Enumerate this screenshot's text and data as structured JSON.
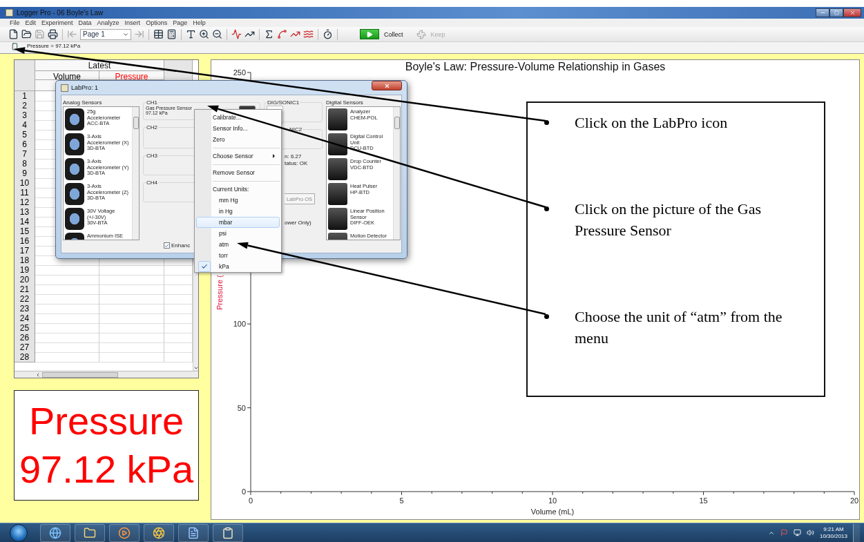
{
  "window": {
    "title": "Logger Pro - 06 Boyle's Law"
  },
  "menu": [
    "File",
    "Edit",
    "Experiment",
    "Data",
    "Analyze",
    "Insert",
    "Options",
    "Page",
    "Help"
  ],
  "toolbar": {
    "page": "Page 1",
    "buttons": [
      {
        "label": "Collect",
        "disabled": false
      },
      {
        "label": "Keep",
        "disabled": true
      }
    ]
  },
  "meter_bar": {
    "reading": "Pressure = 97.12 kPa"
  },
  "table": {
    "group": "Latest",
    "columns": [
      {
        "name": "Volume",
        "color": "#000000"
      },
      {
        "name": "Pressure",
        "color": "#ff0000"
      }
    ],
    "rows": [
      "1",
      "2",
      "3",
      "4",
      "5",
      "6",
      "7",
      "8",
      "9",
      "10",
      "11",
      "12",
      "13",
      "14",
      "15",
      "16",
      "17",
      "18",
      "19",
      "20",
      "21",
      "22",
      "23",
      "24",
      "25",
      "26",
      "27",
      "28"
    ]
  },
  "meter": {
    "label": "Pressure",
    "reading": "97.12 kPa"
  },
  "graph": {
    "chart_data": {
      "type": "line",
      "title": "Boyle's Law: Pressure-Volume Relationship in Gases",
      "xlabel": "Volume (mL)",
      "ylabel": "Pressure (",
      "xlim": [
        0,
        20
      ],
      "ylim": [
        0,
        250
      ],
      "xticks": [
        0,
        5,
        10,
        15,
        20
      ],
      "yticks": [
        0,
        50,
        100,
        250
      ]
    }
  },
  "dialog": {
    "title": "LabPro: 1",
    "analog": {
      "label": "Analog Sensors",
      "items": [
        {
          "lines": [
            "25g",
            "Accelerometer",
            "ACC-BTA"
          ]
        },
        {
          "lines": [
            "3-Axis",
            "Accelerometer (X)",
            "3D-BTA"
          ]
        },
        {
          "lines": [
            "3-Axis",
            "Accelerometer (Y)",
            "3D-BTA"
          ]
        },
        {
          "lines": [
            "3-Axis",
            "Accelerometer (Z)",
            "3D-BTA"
          ]
        },
        {
          "lines": [
            "30V Voltage",
            "(+/-30V)",
            "30V-BTA"
          ]
        },
        {
          "lines": [
            "Ammonium ISE"
          ]
        }
      ]
    },
    "channels": [
      {
        "label": "CH1",
        "sensor": "Gas Pressure Sensor",
        "reading": "97.12 kPa"
      },
      {
        "label": "CH2"
      },
      {
        "label": "CH3"
      },
      {
        "label": "CH4"
      }
    ],
    "enhance": {
      "label": "Enhanc",
      "checked": true
    },
    "ports": [
      {
        "label": "DIG/SONIC1"
      },
      {
        "label": "NIC2"
      }
    ],
    "status": [
      "n: 6.27",
      "tatus: OK"
    ],
    "os_button": "LabPro OS",
    "note": "ower Only)",
    "digital": {
      "label": "Digital Sensors",
      "items": [
        {
          "lines": [
            "Analyzer",
            "CHEM-POL"
          ]
        },
        {
          "lines": [
            "Digital Control",
            "Unit",
            "DCU-BTD"
          ]
        },
        {
          "lines": [
            "Drop Counter",
            "VDC-BTD"
          ]
        },
        {
          "lines": [
            "Heat Pulser",
            "HP-BTD"
          ]
        },
        {
          "lines": [
            "Linear Position",
            "Sensor",
            "DIFF-OEK"
          ]
        },
        {
          "lines": [
            "Motion Detector"
          ]
        }
      ]
    }
  },
  "context_menu": {
    "items": [
      {
        "kind": "action",
        "label": "Calibrate..."
      },
      {
        "kind": "action",
        "label": "Sensor Info..."
      },
      {
        "kind": "action",
        "label": "Zero"
      },
      {
        "kind": "separator"
      },
      {
        "kind": "submenu",
        "label": "Choose Sensor"
      },
      {
        "kind": "separator"
      },
      {
        "kind": "action",
        "label": "Remove Sensor"
      },
      {
        "kind": "separator"
      },
      {
        "kind": "header",
        "label": "Current Units:"
      },
      {
        "kind": "unit",
        "label": "mm Hg",
        "checked": false,
        "hovered": false
      },
      {
        "kind": "unit",
        "label": "in Hg",
        "checked": false,
        "hovered": false
      },
      {
        "kind": "unit",
        "label": "mbar",
        "checked": false,
        "hovered": true
      },
      {
        "kind": "unit",
        "label": "psi",
        "checked": false,
        "hovered": false
      },
      {
        "kind": "unit",
        "label": "atm",
        "checked": false,
        "hovered": false
      },
      {
        "kind": "unit",
        "label": "torr",
        "checked": false,
        "hovered": false
      },
      {
        "kind": "unit",
        "label": "kPa",
        "checked": true,
        "hovered": false
      }
    ]
  },
  "instructions": [
    "Click on the LabPro icon",
    "Click on the picture of the Gas Pressure Sensor",
    "Choose the unit of “atm” from the menu"
  ],
  "taskbar": {
    "time": "9:21 AM",
    "date": "10/30/2013"
  }
}
